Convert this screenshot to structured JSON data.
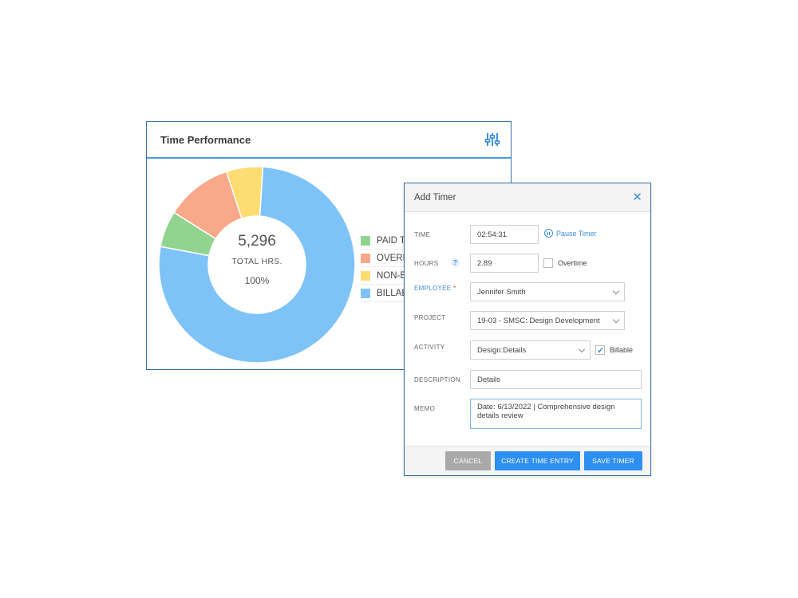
{
  "performance": {
    "title": "Time Performance",
    "icon": "filter-sliders-icon",
    "center": {
      "total": "5,296",
      "label": "TOTAL HRS.",
      "percent": "100%"
    },
    "legend": [
      {
        "label": "PAID TIME OFF",
        "color": "#90d48f"
      },
      {
        "label": "OVERHEAD",
        "color": "#f9a98a"
      },
      {
        "label": "NON-BILLABLE",
        "color": "#fddc72"
      },
      {
        "label": "BILLABLE",
        "color": "#7ec3f7"
      }
    ]
  },
  "chart_data": {
    "type": "pie",
    "categories": [
      "PAID TIME OFF",
      "OVERHEAD",
      "NON-BILLABLE",
      "BILLABLE"
    ],
    "values": [
      6,
      11,
      6,
      77
    ],
    "colors": [
      "#90d48f",
      "#f9a98a",
      "#fddc72",
      "#7ec3f7"
    ]
  },
  "dialog": {
    "title": "Add Timer",
    "close_icon": "close-icon",
    "time": {
      "label": "TIME",
      "value": "02:54:31",
      "pause_label": "Pause Timer"
    },
    "hours": {
      "label": "HOURS",
      "help": "?",
      "value": "2.89",
      "overtime_label": "Overtime",
      "overtime_checked": false
    },
    "employee": {
      "label": "EMPLOYEE",
      "required_mark": "*",
      "value": "Jennifer Smith"
    },
    "project": {
      "label": "PROJECT",
      "value": "19-03 - SMSC: Design Development"
    },
    "activity": {
      "label": "ACTIVITY",
      "value": "Design:Details",
      "billable_label": "Billable",
      "billable_checked": true
    },
    "description": {
      "label": "DESCRIPTION",
      "value": "Details"
    },
    "memo": {
      "label": "MEMO",
      "value": "Date: 6/13/2022 | Comprehensive design details review"
    },
    "buttons": {
      "cancel": "CANCEL",
      "create": "CREATE TIME ENTRY",
      "save": "SAVE TIMER"
    }
  }
}
